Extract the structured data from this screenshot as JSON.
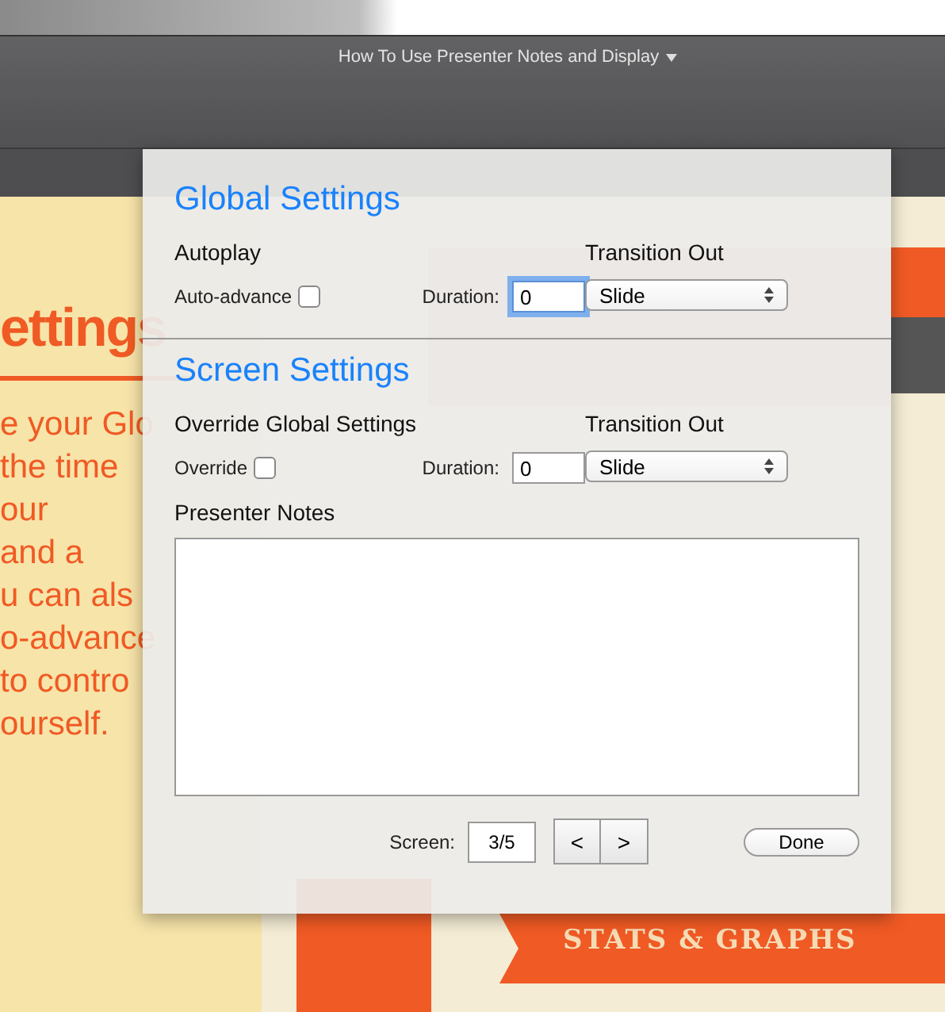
{
  "window": {
    "title": "How To Use Presenter Notes and Display"
  },
  "slide": {
    "heading": "ettings",
    "lines": [
      "e your Glo",
      "the time",
      "our",
      "and a",
      "u can als",
      "o-advance",
      "to contro",
      "ourself."
    ],
    "banner": "STATS & GRAPHS"
  },
  "dialog": {
    "sections": [
      {
        "title": "Global Settings",
        "group_label": "Autoplay",
        "checkbox_label": "Auto-advance",
        "checked": false,
        "duration_label": "Duration:",
        "duration": "0",
        "focused": true,
        "transition_label": "Transition Out",
        "transition": "Slide"
      },
      {
        "title": "Screen Settings",
        "group_label": "Override Global Settings",
        "checkbox_label": "Override",
        "checked": false,
        "duration_label": "Duration:",
        "duration": "0",
        "focused": false,
        "transition_label": "Transition Out",
        "transition": "Slide"
      }
    ],
    "notes_label": "Presenter Notes",
    "screen_label": "Screen:",
    "screen_value": "3/5",
    "prev": "<",
    "next": ">",
    "done": "Done"
  }
}
